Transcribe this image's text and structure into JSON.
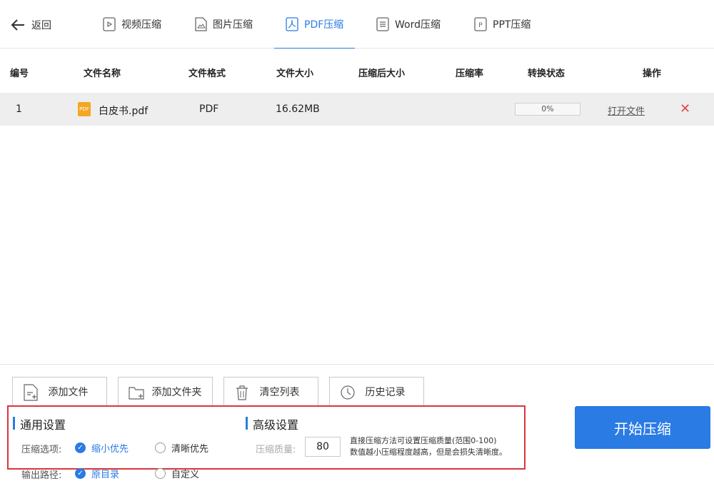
{
  "nav": {
    "back_label": "返回",
    "tabs": [
      {
        "label": "视频压缩",
        "icon": "video-file-icon"
      },
      {
        "label": "图片压缩",
        "icon": "image-file-icon"
      },
      {
        "label": "PDF压缩",
        "icon": "pdf-icon"
      },
      {
        "label": "Word压缩",
        "icon": "word-doc-icon"
      },
      {
        "label": "PPT压缩",
        "icon": "ppt-icon"
      }
    ],
    "active_tab": "PDF压缩"
  },
  "table": {
    "headers": [
      "编号",
      "文件名称",
      "文件格式",
      "文件大小",
      "压缩后大小",
      "压缩率",
      "转换状态",
      "操作"
    ],
    "rows": [
      {
        "index": "1",
        "name": "白皮书.pdf",
        "file_icon_text": "PDF",
        "format": "PDF",
        "size": "16.62MB",
        "compressed_size": "",
        "ratio": "",
        "progress": "0%",
        "progress_value": 0,
        "action": "打开文件"
      }
    ]
  },
  "actions": {
    "add_file": "添加文件",
    "add_folder": "添加文件夹",
    "clear_list": "清空列表",
    "history": "历史记录"
  },
  "settings": {
    "general_title": "通用设置",
    "compress_option_label": "压缩选项:",
    "option_small": "缩小优先",
    "option_clear": "清晰优先",
    "selected_option": "缩小优先",
    "output_label": "输出路径:",
    "output_original": "原目录",
    "output_custom": "自定义",
    "advanced_title": "高级设置",
    "quality_label": "压缩质量:",
    "quality_value": "80",
    "hint_line1": "直接压缩方法可设置压缩质量(范围0-100)",
    "hint_line2": "数值越小压缩程度越高，但是会损失清晰度。"
  },
  "start_button": "开始压缩",
  "colors": {
    "accent": "#2a7be4",
    "highlight_border": "#d9363e",
    "delete": "#e04848"
  }
}
